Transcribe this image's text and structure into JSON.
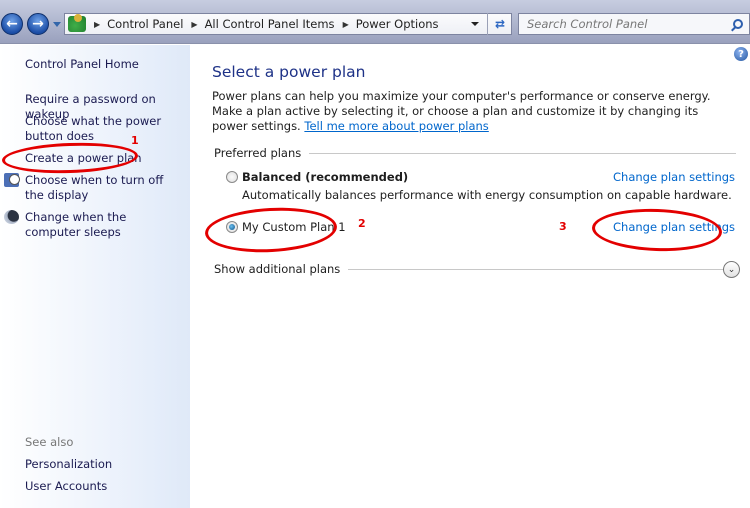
{
  "toolbar": {
    "breadcrumb": [
      "Control Panel",
      "All Control Panel Items",
      "Power Options"
    ],
    "search_placeholder": "Search Control Panel",
    "back_icon": "back-arrow-icon",
    "forward_icon": "forward-arrow-icon"
  },
  "sidebar": {
    "home": "Control Panel Home",
    "items": [
      {
        "label": "Require a password on wakeup"
      },
      {
        "label": "Choose what the power button does"
      },
      {
        "label": "Create a power plan"
      },
      {
        "label": "Choose when to turn off the display",
        "icon": "clock-icon"
      },
      {
        "label": "Change when the computer sleeps",
        "icon": "moon-icon"
      }
    ],
    "see_also": "See also",
    "see_also_items": [
      "Personalization",
      "User Accounts"
    ]
  },
  "main": {
    "title": "Select a power plan",
    "description": "Power plans can help you maximize your computer's performance or conserve energy. Make a plan active by selecting it, or choose a plan and customize it by changing its power settings.",
    "description_link": "Tell me more about power plans",
    "preferred_label": "Preferred plans",
    "plans": [
      {
        "name": "Balanced (recommended)",
        "selected": false,
        "description": "Automatically balances performance with energy consumption on capable hardware.",
        "link": "Change plan settings"
      },
      {
        "name": "My Custom Plan 1",
        "selected": true,
        "link": "Change plan settings"
      }
    ],
    "show_additional": "Show additional plans"
  },
  "annotations": {
    "color": "#e30000",
    "labels": [
      "1",
      "2",
      "3"
    ]
  }
}
